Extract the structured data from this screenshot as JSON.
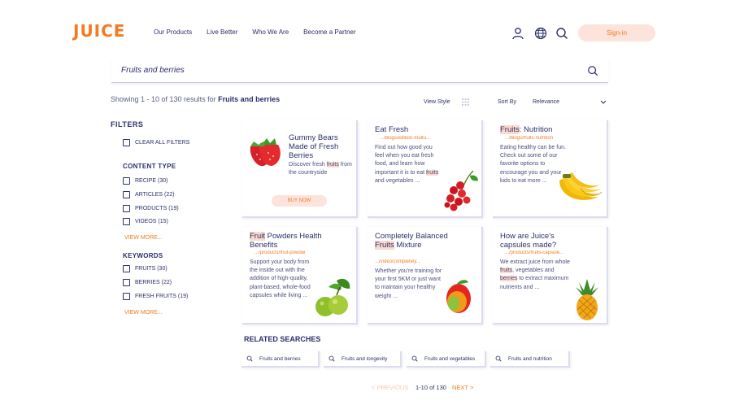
{
  "header": {
    "logo": "JUICE",
    "nav": [
      "Our Products",
      "Live Better",
      "Who We Are",
      "Become a Partner"
    ],
    "signin_label": "Sign-in"
  },
  "search": {
    "query": "Fruits and berries"
  },
  "results": {
    "showing_prefix": "Showing 1 - 10 of 130 results for",
    "showing_query": "Fruits and berries",
    "view_style_label": "View Style",
    "sort_by_label": "Sort By",
    "sort_value": "Relevance"
  },
  "filters": {
    "title": "FILTERS",
    "clear_all": "CLEAR ALL FILTERS",
    "content_type": {
      "title": "CONTENT TYPE",
      "items": [
        "RECIPE (30)",
        "ARTICLES (22)",
        "PRODUCTS (19)",
        "VIDEOS (15)"
      ],
      "view_more": "VIEW MORE..."
    },
    "keywords": {
      "title": "KEYWORDS",
      "items": [
        "FRUITS (30)",
        "BERRIES (22)",
        "FRESH FRUITS (19)"
      ],
      "view_more": "VIEW MORE..."
    }
  },
  "cards": [
    {
      "title": "Gummy Bears Made of Fresh Berries",
      "desc_pre": "Discover fresh ",
      "desc_hl": "fruits",
      "desc_post": " from the countryside",
      "button": "BUY NOW",
      "image": "strawberry-icon"
    },
    {
      "title": "Eat Fresh",
      "url": ".../blogs/edition-multu...",
      "desc_pre": "Find out how good you feel when you eat fresh food, and learn how important it is to eat ",
      "desc_hl": "fruits",
      "desc_post": " and vegetables ...",
      "image": "redcurrant-icon"
    },
    {
      "title_hl": "Fruits",
      "title_post": ": Nutrition",
      "url": ".../blogs/fruits-nutrition",
      "desc": "Eating healthy can be fun. Check out some of our favorite options to encourage you and your kids to eat more ...",
      "image": "banana-icon"
    },
    {
      "title_hl": "Fruit",
      "title_post": " Powders Health Benefits",
      "url": ".../products/fruit-powder",
      "desc": "Support your body from the inside out with the addition of high-quality, plant-based, whole-food capsules while living ...",
      "image": "apple-green-icon"
    },
    {
      "title_pre": "Completely Balanced ",
      "title_hl": "Fruits",
      "title_post": " Mixture",
      "url": ".../video/completely...",
      "desc": "Whether you're training for your first 5KM or just want to maintain your healthy weight ...",
      "image": "mango-icon"
    },
    {
      "title": "How are Juice's capsules made?",
      "url": ".../products/fruits-capsule...",
      "desc_pre": "We extract juice from whole ",
      "desc_hl": "fruits",
      "desc_mid": ", vegetables and ",
      "desc_hl2": "berries",
      "desc_post": " to extract maximum nutrients and ...",
      "image": "pineapple-icon"
    }
  ],
  "related": {
    "title": "RELATED SEARCHES",
    "items": [
      "Fruits and berries",
      "Fruits and longevity",
      "Fruits and vegetables",
      "Fruits and nutrition"
    ]
  },
  "pagination": {
    "previous": "< PREVIOUS",
    "range": "1-10 of 130",
    "next": "NEXT >"
  },
  "colors": {
    "accent": "#f47b20",
    "text": "#2b2f6b",
    "highlight": "#fcd9cf"
  }
}
